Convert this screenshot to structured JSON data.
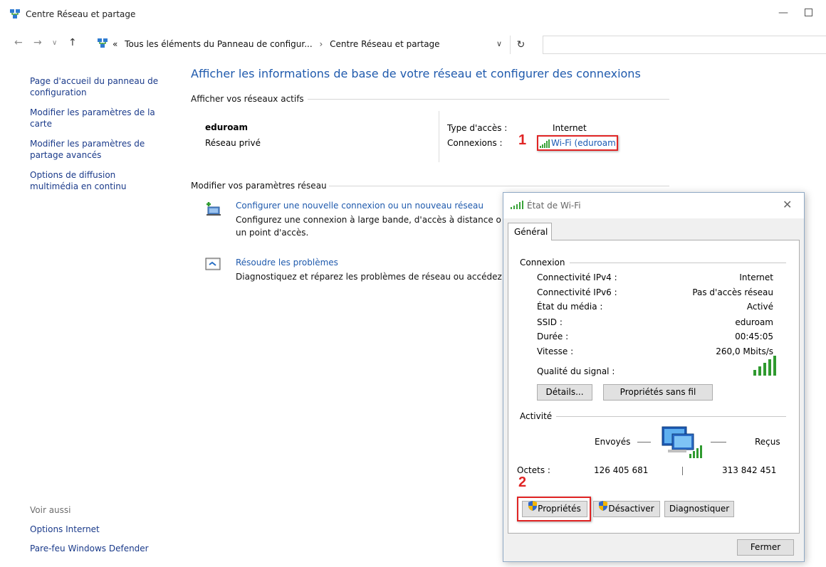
{
  "window": {
    "title": "Centre Réseau et partage"
  },
  "address": {
    "crumb_prefix": "«",
    "crumb_1": "Tous les éléments du Panneau de configur...",
    "crumb_sep": "›",
    "crumb_2": "Centre Réseau et partage"
  },
  "left_pane": {
    "items": [
      "Page d'accueil du panneau de configuration",
      "Modifier les paramètres de la carte",
      "Modifier les paramètres de partage avancés",
      "Options de diffusion multimédia en continu"
    ],
    "see_also": "Voir aussi",
    "see_also_items": [
      "Options Internet",
      "Pare-feu Windows Defender"
    ]
  },
  "main": {
    "title": "Afficher les informations de base de votre réseau et configurer des connexions",
    "active_networks_header": "Afficher vos réseaux actifs",
    "network_name": "eduroam",
    "network_type": "Réseau privé",
    "access_type_label": "Type d'accès :",
    "access_type_value": "Internet",
    "connections_label": "Connexions :",
    "connection_value": "Wi-Fi (eduroam",
    "step1": "1",
    "modify_header": "Modifier vos paramètres réseau",
    "task1_link": "Configurer une nouvelle connexion ou un nouveau réseau",
    "task1_desc": "Configurez une connexion à large bande, d'accès à distance o un point d'accès.",
    "task2_link": "Résoudre les problèmes",
    "task2_desc": "Diagnostiquez et réparez les problèmes de réseau ou accédez"
  },
  "dialog": {
    "title": "État de Wi-Fi",
    "tab": "Général",
    "connection_group": "Connexion",
    "rows": [
      {
        "label": "Connectivité IPv4 :",
        "value": "Internet"
      },
      {
        "label": "Connectivité IPv6 :",
        "value": "Pas d'accès réseau"
      },
      {
        "label": "État du média :",
        "value": "Activé"
      },
      {
        "label": "SSID :",
        "value": "eduroam"
      },
      {
        "label": "Durée :",
        "value": "00:45:05"
      },
      {
        "label": "Vitesse :",
        "value": "260,0 Mbits/s"
      }
    ],
    "signal_label": "Qualité du signal :",
    "signal_bars": 5,
    "details_btn": "Détails...",
    "wireless_props_btn": "Propriétés sans fil",
    "activity_group": "Activité",
    "sent_label": "Envoyés",
    "received_label": "Reçus",
    "bytes_label": "Octets :",
    "bytes_sent": "126 405 681",
    "bytes_received": "313 842 451",
    "step2": "2",
    "properties_btn": "Propriétés",
    "disable_btn": "Désactiver",
    "diagnose_btn": "Diagnostiquer",
    "close_btn": "Fermer"
  }
}
